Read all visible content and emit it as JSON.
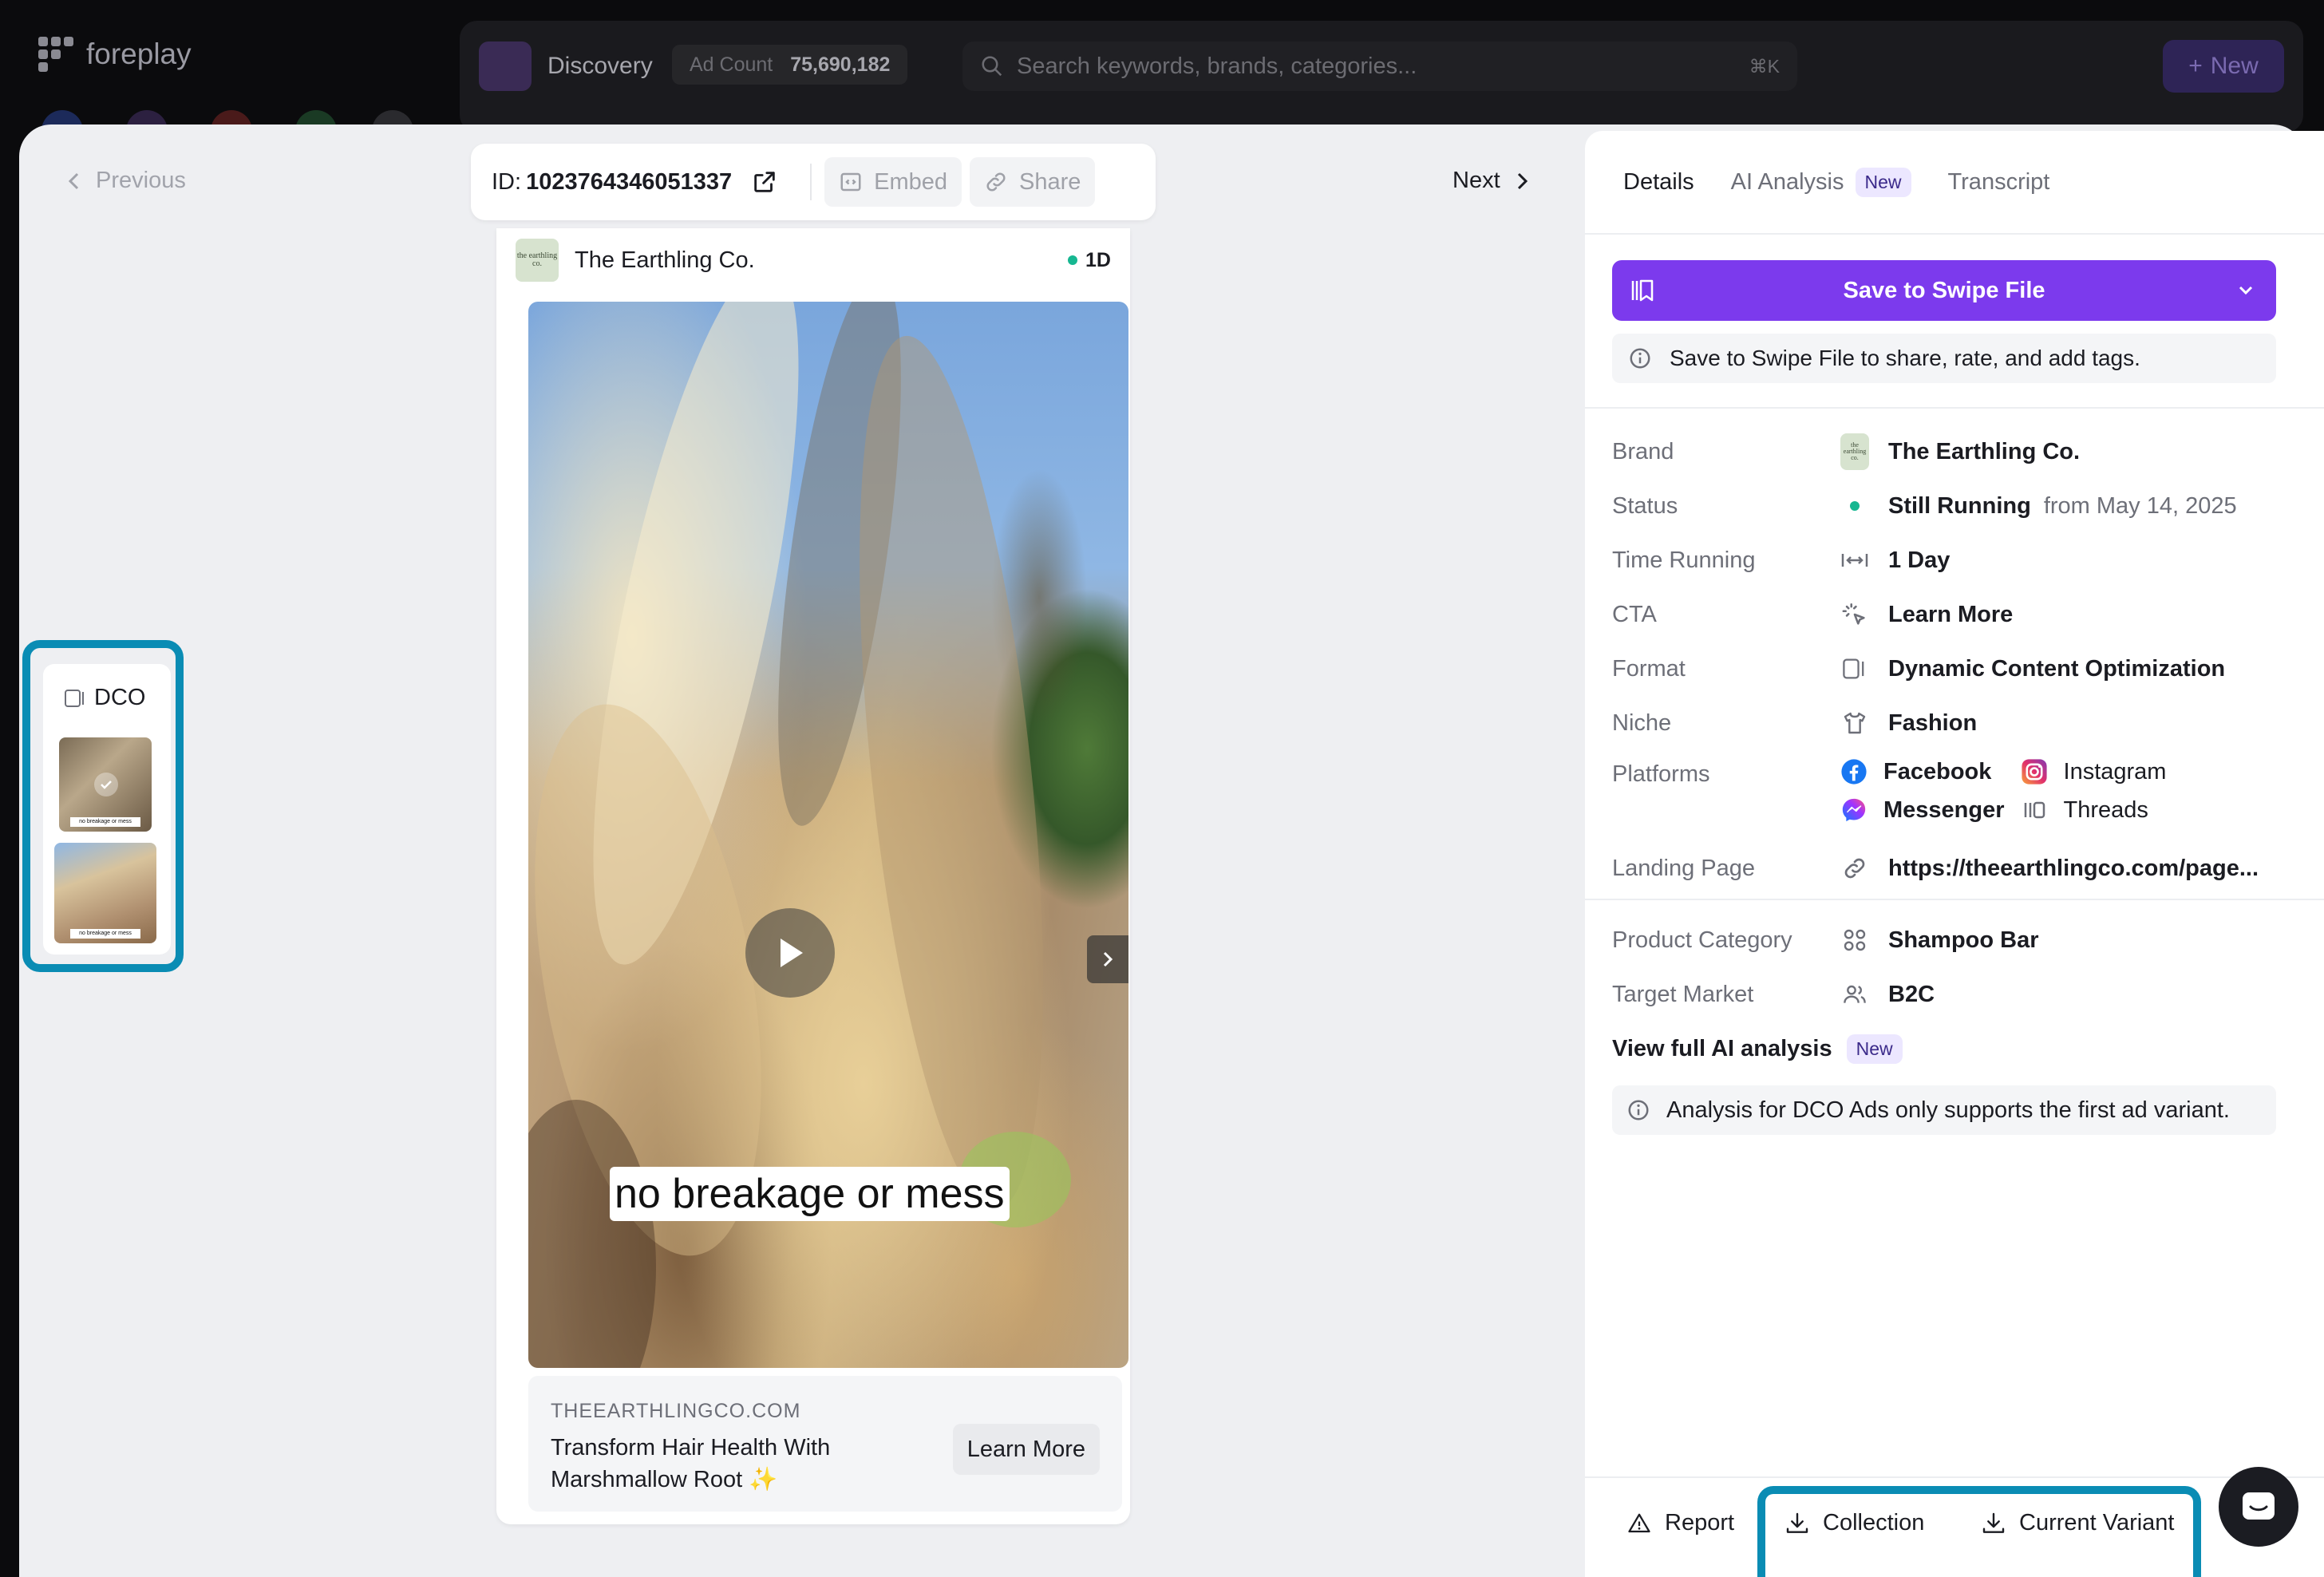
{
  "background_app": {
    "logo_text": "foreplay",
    "page_title": "Discovery",
    "ad_count_label": "Ad Count",
    "ad_count_value": "75,690,182",
    "search_placeholder": "Search keywords, brands, categories...",
    "search_shortcut": "⌘K",
    "new_button_label": "New"
  },
  "modal": {
    "previous_label": "Previous",
    "next_label": "Next",
    "id_label": "ID:",
    "id_value": "1023764346051337",
    "embed_label": "Embed",
    "share_label": "Share"
  },
  "ad": {
    "brand_name": "The Earthling Co.",
    "brand_logo_text": "the earthling co.",
    "age_badge": "1D",
    "caption": "no breakage or mess",
    "domain": "THEEARTHLINGCO.COM",
    "headline": "Transform Hair Health With Marshmallow Root ✨",
    "cta_label": "Learn More"
  },
  "dco": {
    "label": "DCO",
    "thumb_caption": "no breakage or mess"
  },
  "panel": {
    "tabs": [
      {
        "label": "Details",
        "active": true
      },
      {
        "label": "AI Analysis",
        "badge": "New"
      },
      {
        "label": "Transcript"
      }
    ],
    "save_button_label": "Save to Swipe File",
    "save_info": "Save to Swipe File to share, rate, and add tags.",
    "details": {
      "brand": {
        "key": "Brand",
        "value": "The Earthling Co."
      },
      "status": {
        "key": "Status",
        "value": "Still Running",
        "extra": "from May 14, 2025"
      },
      "time_running": {
        "key": "Time Running",
        "value": "1 Day"
      },
      "cta": {
        "key": "CTA",
        "value": "Learn More"
      },
      "format": {
        "key": "Format",
        "value": "Dynamic Content Optimization"
      },
      "niche": {
        "key": "Niche",
        "value": "Fashion"
      },
      "platforms": {
        "key": "Platforms",
        "items": [
          "Facebook",
          "Instagram",
          "Messenger",
          "Threads"
        ]
      },
      "landing_page": {
        "key": "Landing Page",
        "value": "https://theearthlingco.com/page..."
      },
      "product_category": {
        "key": "Product Category",
        "value": "Shampoo Bar"
      },
      "target_market": {
        "key": "Target Market",
        "value": "B2C"
      }
    },
    "view_full_label": "View full AI analysis",
    "view_full_badge": "New",
    "dco_info": "Analysis for DCO Ads only supports the first ad variant.",
    "footer": {
      "report_label": "Report",
      "collection_label": "Collection",
      "current_variant_label": "Current Variant"
    }
  },
  "colors": {
    "accent_purple": "#7c3aed",
    "highlight_teal": "#0a8cb4",
    "status_green": "#16b791"
  }
}
